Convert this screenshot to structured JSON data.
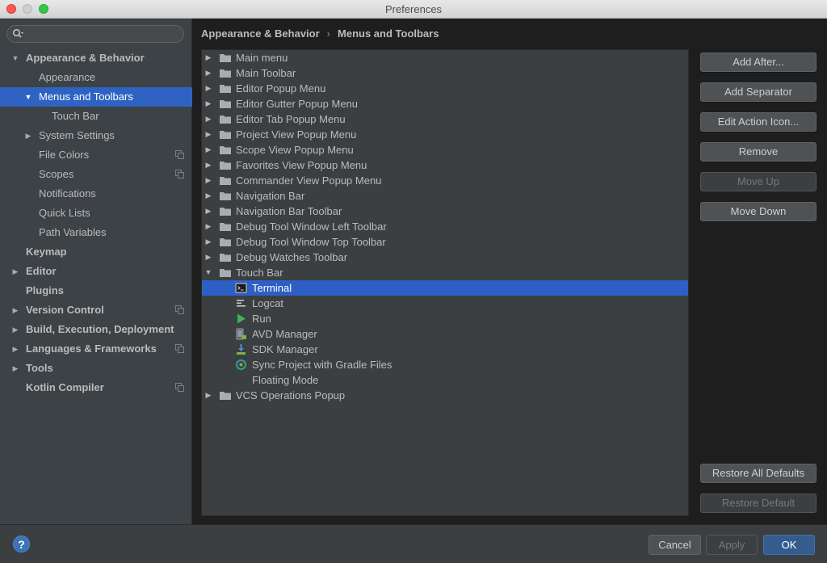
{
  "window": {
    "title": "Preferences"
  },
  "search": {
    "placeholder": ""
  },
  "sidebar": {
    "items": [
      {
        "label": "Appearance & Behavior",
        "expanded": true,
        "bold": true
      },
      {
        "label": "Appearance"
      },
      {
        "label": "Menus and Toolbars",
        "expanded": true,
        "selected": true
      },
      {
        "label": "Touch Bar"
      },
      {
        "label": "System Settings",
        "expandable": true
      },
      {
        "label": "File Colors",
        "project_icon": true
      },
      {
        "label": "Scopes",
        "project_icon": true
      },
      {
        "label": "Notifications"
      },
      {
        "label": "Quick Lists"
      },
      {
        "label": "Path Variables"
      },
      {
        "label": "Keymap",
        "bold": true
      },
      {
        "label": "Editor",
        "bold": true,
        "expandable": true
      },
      {
        "label": "Plugins",
        "bold": true
      },
      {
        "label": "Version Control",
        "bold": true,
        "expandable": true,
        "project_icon": true
      },
      {
        "label": "Build, Execution, Deployment",
        "bold": true,
        "expandable": true
      },
      {
        "label": "Languages & Frameworks",
        "bold": true,
        "expandable": true,
        "project_icon": true
      },
      {
        "label": "Tools",
        "bold": true,
        "expandable": true
      },
      {
        "label": "Kotlin Compiler",
        "bold": true,
        "project_icon": true
      }
    ]
  },
  "breadcrumb": {
    "parent": "Appearance & Behavior",
    "separator": "›",
    "current": "Menus and Toolbars"
  },
  "tree": {
    "rows": [
      {
        "label": "Main menu",
        "type": "folder"
      },
      {
        "label": "Main Toolbar",
        "type": "folder"
      },
      {
        "label": "Editor Popup Menu",
        "type": "folder"
      },
      {
        "label": "Editor Gutter Popup Menu",
        "type": "folder"
      },
      {
        "label": "Editor Tab Popup Menu",
        "type": "folder"
      },
      {
        "label": "Project View Popup Menu",
        "type": "folder"
      },
      {
        "label": "Scope View Popup Menu",
        "type": "folder"
      },
      {
        "label": "Favorites View Popup Menu",
        "type": "folder"
      },
      {
        "label": "Commander View Popup Menu",
        "type": "folder"
      },
      {
        "label": "Navigation Bar",
        "type": "folder"
      },
      {
        "label": "Navigation Bar Toolbar",
        "type": "folder"
      },
      {
        "label": "Debug Tool Window Left Toolbar",
        "type": "folder"
      },
      {
        "label": "Debug Tool Window Top Toolbar",
        "type": "folder"
      },
      {
        "label": "Debug Watches Toolbar",
        "type": "folder"
      },
      {
        "label": "Touch Bar",
        "type": "folder",
        "expanded": true
      },
      {
        "label": "Terminal",
        "type": "action",
        "icon": "terminal-icon",
        "selected": true
      },
      {
        "label": "Logcat",
        "type": "action",
        "icon": "logcat-icon"
      },
      {
        "label": "Run",
        "type": "action",
        "icon": "run-icon"
      },
      {
        "label": "AVD Manager",
        "type": "action",
        "icon": "avd-manager-icon"
      },
      {
        "label": "SDK Manager",
        "type": "action",
        "icon": "sdk-manager-icon"
      },
      {
        "label": "Sync Project with Gradle Files",
        "type": "action",
        "icon": "gradle-sync-icon"
      },
      {
        "label": "Floating Mode",
        "type": "action",
        "icon": ""
      },
      {
        "label": "VCS Operations Popup",
        "type": "folder"
      }
    ]
  },
  "actions": {
    "add_after": "Add After...",
    "add_separator": "Add Separator",
    "edit_action_icon": "Edit Action Icon...",
    "remove": "Remove",
    "move_up": "Move Up",
    "move_down": "Move Down",
    "restore_all_defaults": "Restore All Defaults",
    "restore_default": "Restore Default"
  },
  "footer": {
    "help": "?",
    "cancel": "Cancel",
    "apply": "Apply",
    "ok": "OK"
  },
  "colors": {
    "selection": "#2e63c4",
    "sidebar_bg": "#3d4246",
    "panel_bg": "#3c3f41",
    "run_green": "#3fb34f",
    "sync_teal": "#2aa198"
  }
}
